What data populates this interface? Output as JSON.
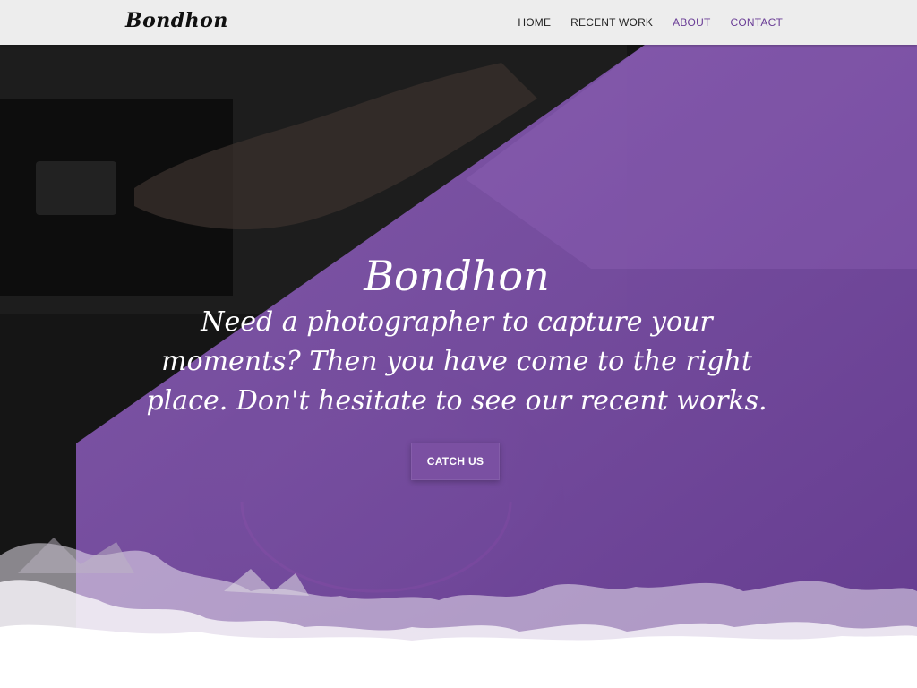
{
  "navbar": {
    "brand": "Bondhon",
    "links": [
      {
        "label": "HOME",
        "accent": false
      },
      {
        "label": "RECENT WORK",
        "accent": false
      },
      {
        "label": "ABOUT",
        "accent": true
      },
      {
        "label": "CONTACT",
        "accent": true
      }
    ]
  },
  "hero": {
    "title": "Bondhon",
    "subtitle": "Need a photographer to capture your moments? Then you have come to the right place. Don't hesitate to see our recent works.",
    "cta_label": "CATCH US"
  },
  "colors": {
    "accent": "#6a3d96",
    "overlay": "#7a4fa6",
    "navbar_bg": "#f5f5f5"
  }
}
